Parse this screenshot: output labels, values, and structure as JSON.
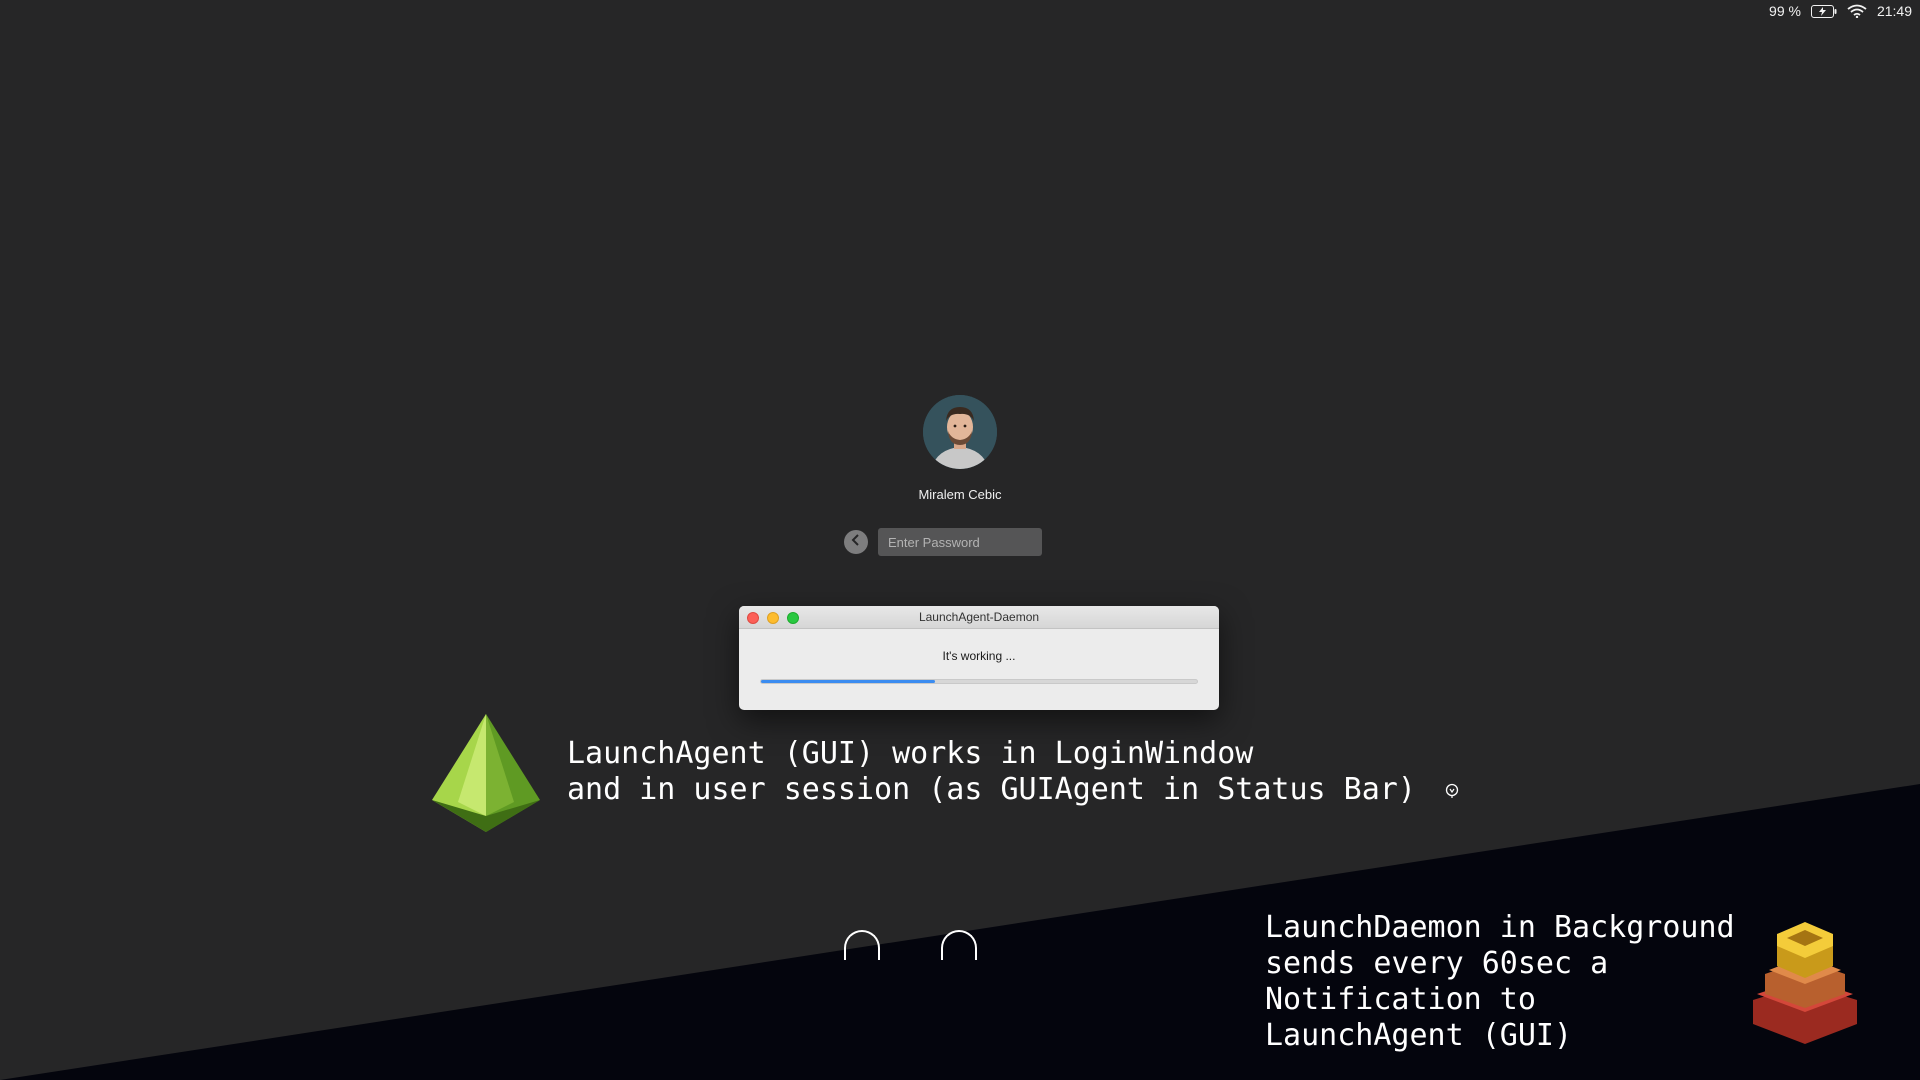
{
  "status_bar": {
    "battery_percent": "99 %",
    "battery_icon": "battery-charging-icon",
    "wifi_icon": "wifi-icon",
    "time": "21:49"
  },
  "login": {
    "user_name": "Miralem Cebic",
    "password_placeholder": "Enter Password",
    "back_icon": "chevron-left-icon"
  },
  "dialog": {
    "title": "LaunchAgent-Daemon",
    "status_text": "It's working ...",
    "progress": 0.4
  },
  "captions": {
    "agent_line1": "LaunchAgent (GUI) works in LoginWindow",
    "agent_line2": "and in user session (as GUIAgent in Status Bar)",
    "daemon_line1": "LaunchDaemon in Background",
    "daemon_line2": "sends every 60sec a",
    "daemon_line3": "Notification to",
    "daemon_line4": "LaunchAgent (GUI)"
  },
  "colors": {
    "background": "#262627",
    "dark_wedge": "#04050d",
    "progress_fill": "#3b8cf0",
    "pyramid_green": "#8cc63f",
    "stack_red": "#c0392b",
    "stack_yellow": "#f1c40f"
  }
}
